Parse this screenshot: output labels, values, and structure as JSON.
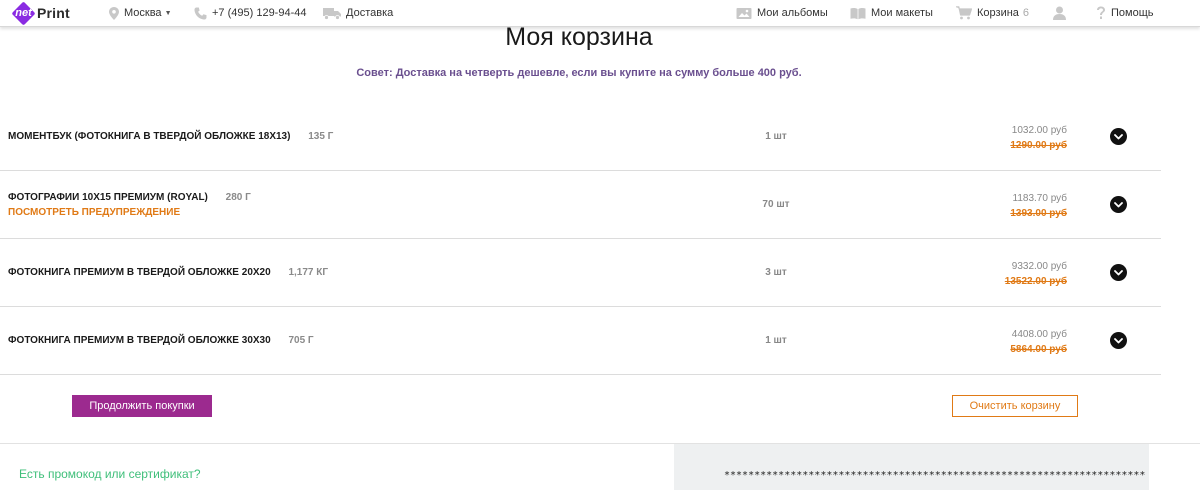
{
  "logo": {
    "net": "net",
    "print": "Print"
  },
  "nav": {
    "city": "Москва",
    "phone": "+7 (495) 129-94-44",
    "delivery": "Доставка",
    "albums": "Мои альбомы",
    "layouts": "Мои макеты",
    "cart": "Корзина",
    "cart_count": "6",
    "help": "Помощь"
  },
  "page": {
    "title": "Моя корзина",
    "tip": "Совет: Доставка на четверть дешевле, если вы купите на сумму больше 400 руб."
  },
  "items": [
    {
      "title": "Моментбук (фотокнига в твердой обложке 18х13)",
      "weight": "135 г",
      "warning": "",
      "qty": "1 шт",
      "price": "1032.00 руб",
      "old_price": "1290.00 руб"
    },
    {
      "title": "Фотографии 10х15 премиум (Royal)",
      "weight": "280 г",
      "warning": "Посмотреть предупреждение",
      "qty": "70 шт",
      "price": "1183.70 руб",
      "old_price": "1393.00 руб"
    },
    {
      "title": "Фотокнига премиум в твердой обложке 20х20",
      "weight": "1,177 кг",
      "warning": "",
      "qty": "3 шт",
      "price": "9332.00 руб",
      "old_price": "13522.00 руб"
    },
    {
      "title": "Фотокнига премиум в твердой обложке 30х30",
      "weight": "705 г",
      "warning": "",
      "qty": "1 шт",
      "price": "4408.00 руб",
      "old_price": "5864.00 руб"
    }
  ],
  "actions": {
    "continue": "Продолжить покупки",
    "clear": "Очистить корзину"
  },
  "promo": {
    "link": "Есть промокод или сертификат?"
  },
  "summary": {
    "masked": "**********************************************************************"
  },
  "colors": {
    "brand": "#8a2be2",
    "accent_orange": "#e07a16",
    "button_purple": "#9c2a8f",
    "promo_green": "#3fbf7a"
  }
}
